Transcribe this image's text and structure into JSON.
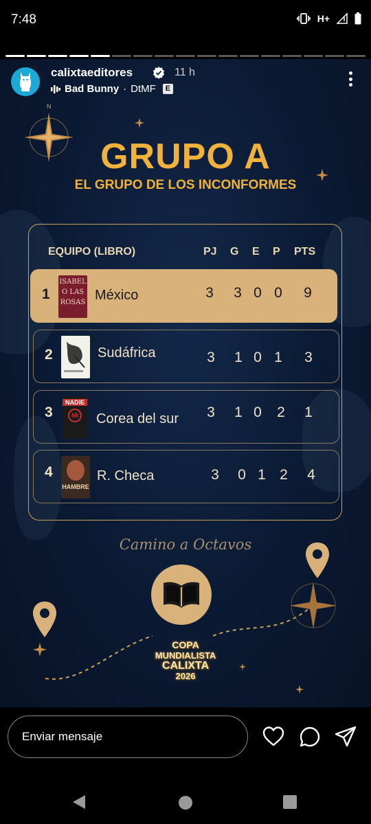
{
  "status_bar": {
    "time": "7:48",
    "network": "H+"
  },
  "story": {
    "username": "calixtaeditores",
    "time_ago": "11 h",
    "music_artist": "Bad Bunny",
    "music_separator": "·",
    "music_song": "DtMF",
    "explicit_badge": "E",
    "segments_total": 17,
    "segments_done": 5
  },
  "graphic": {
    "title": "GRUPO A",
    "subtitle": "EL GRUPO DE LOS INCONFORMES",
    "table_headers": {
      "team": "EQUIPO (LIBRO)",
      "pj": "PJ",
      "g": "G",
      "e": "E",
      "p": "P",
      "pts": "PTS"
    },
    "rows": [
      {
        "rank": "1",
        "team": "México",
        "pj": "3",
        "g": "3",
        "e": "0",
        "p": "0",
        "pts": "9",
        "cover_text": [
          "ISABEL",
          "O LAS",
          "ROSAS"
        ]
      },
      {
        "rank": "2",
        "team": "Sudáfrica",
        "pj": "3",
        "g": "1",
        "e": "0",
        "p": "1",
        "pts": "3"
      },
      {
        "rank": "3",
        "team": "Corea del sur",
        "pj": "3",
        "g": "1",
        "e": "0",
        "p": "2",
        "pts": "1",
        "cover_text": [
          "NADIE",
          "MI"
        ]
      },
      {
        "rank": "4",
        "team": "R. Checa",
        "pj": "3",
        "g": "0",
        "e": "1",
        "p": "2",
        "pts": "4",
        "cover_text": [
          "HAMBRE"
        ]
      }
    ],
    "tagline": "Camino a Octavos",
    "logo_lines": [
      "COPA",
      "MUNDIALISTA",
      "CALIXTA",
      "2026"
    ]
  },
  "message_bar": {
    "placeholder": "Enviar mensaje"
  },
  "colors": {
    "gold": "#f0b23a",
    "highlight": "#d8b27a",
    "navy": "#0b1a33",
    "avatar": "#1ba9d6"
  }
}
